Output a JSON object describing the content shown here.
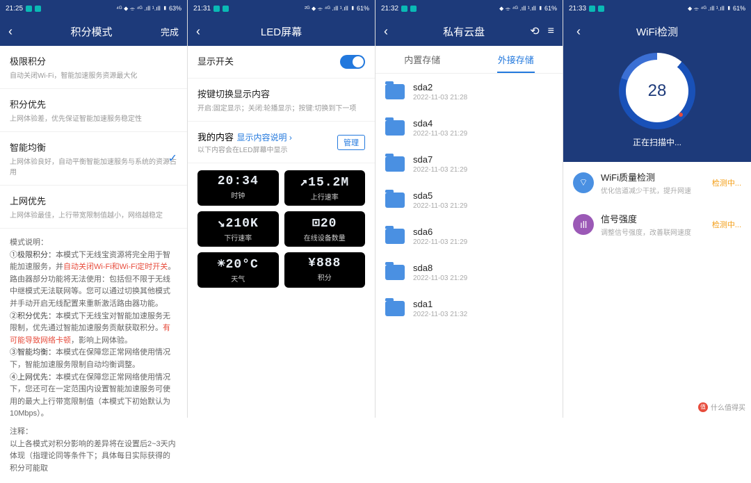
{
  "panel1": {
    "status": {
      "time": "21:25",
      "right": "⁴ᴳ ⬥ ⌯ ⁴ᴳ .ıll ¹.ıll ▮ 63%"
    },
    "header": {
      "title": "积分模式",
      "done": "完成"
    },
    "modes": [
      {
        "title": "极限积分",
        "sub": "自动关闭Wi-Fi，智能加速服务资源最大化"
      },
      {
        "title": "积分优先",
        "sub": "上网体验差，优先保证智能加速服务稳定性"
      },
      {
        "title": "智能均衡",
        "sub": "上网体验良好，自动平衡智能加速服务与系统的资源占用",
        "checked": true
      },
      {
        "title": "上网优先",
        "sub": "上网体验最佳，上行带宽限制值越小，网络越稳定"
      }
    ],
    "desc": {
      "heading": "模式说明：",
      "p1a": "①极限积分：",
      "p1b": "本模式下无线宝资源将完全用于智能加速服务，并",
      "p1r": "自动关闭Wi-Fi和Wi-Fi定时开关",
      "p1c": "。路由器部分功能将无法使用：包括但不限于无线中继模式无法联网等。您可以通过切换其他模式并手动开启无线配置来重新激活路由器功能。",
      "p2a": "②积分优先：",
      "p2b": "本模式下无线宝对智能加速服务无限制，优先通过智能加速服务贡献获取积分。",
      "p2r": "有可能导致网络卡顿",
      "p2c": "，影响上网体验。",
      "p3a": "③智能均衡：",
      "p3b": "本模式在保障您正常网络使用情况下，智能加速服务限制自动均衡调整。",
      "p4a": "④上网优先：",
      "p4b": "本模式在保障您正常网络使用情况下，您还可在一定范围内设置智能加速服务可使用的最大上行带宽限制值（本模式下初始默认为10Mbps）。",
      "note_h": "注释：",
      "note": "以上各模式对积分影响的差异将在设置后2~3天内体现（指理论同等条件下；具体每日实际获得的积分可能取"
    }
  },
  "panel2": {
    "status": {
      "time": "21:31",
      "right": "²ᴳ ⬥ ⌯ ⁴ᴳ .ıll ¹.ıll ▮ 61%"
    },
    "header": {
      "title": "LED屏幕"
    },
    "sw_label": "显示开关",
    "key_label": "按键切换显示内容",
    "key_sub": "开启:固定显示；关闭:轮播显示；按键:切换到下一项",
    "my_content": "我的内容",
    "content_help": "显示内容说明",
    "content_sub": "以下内容会在LED屏幕中显示",
    "manage": "管理",
    "tiles": [
      {
        "value": "20:34",
        "label": "时钟"
      },
      {
        "value": "↗15.2M",
        "label": "上行速率"
      },
      {
        "value": "↘210K",
        "label": "下行速率"
      },
      {
        "value": "⊡20",
        "label": "在线设备数量"
      },
      {
        "value": "☀20°C",
        "label": "天气"
      },
      {
        "value": "¥888",
        "label": "积分"
      }
    ]
  },
  "panel3": {
    "status": {
      "time": "21:32",
      "right": "⬥ ⌯ ⁴ᴳ .ıll ¹.ıll ▮ 61%"
    },
    "header": {
      "title": "私有云盘"
    },
    "tabs": {
      "internal": "内置存储",
      "external": "外接存储"
    },
    "folders": [
      {
        "name": "sda2",
        "date": "2022-11-03 21:28"
      },
      {
        "name": "sda4",
        "date": "2022-11-03 21:29"
      },
      {
        "name": "sda7",
        "date": "2022-11-03 21:29"
      },
      {
        "name": "sda5",
        "date": "2022-11-03 21:29"
      },
      {
        "name": "sda6",
        "date": "2022-11-03 21:29"
      },
      {
        "name": "sda8",
        "date": "2022-11-03 21:29"
      },
      {
        "name": "sda1",
        "date": "2022-11-03 21:32"
      }
    ]
  },
  "panel4": {
    "status": {
      "time": "21:33",
      "right": "⬥ ⌯ ⁴ᴳ .ıll ¹.ıll ▮ 61%"
    },
    "header": {
      "title": "WiFi检测"
    },
    "gauge_value": "28",
    "scanning": "正在扫描中...",
    "items": [
      {
        "icon": "wifi",
        "color": "blue",
        "title": "WiFi质量检测",
        "sub": "优化信道减少干扰，提升网速",
        "status": "检测中..."
      },
      {
        "icon": "signal",
        "color": "purple",
        "title": "信号强度",
        "sub": "调整信号强度，改善联网速度",
        "status": "检测中..."
      }
    ]
  },
  "watermark": "什么值得买"
}
